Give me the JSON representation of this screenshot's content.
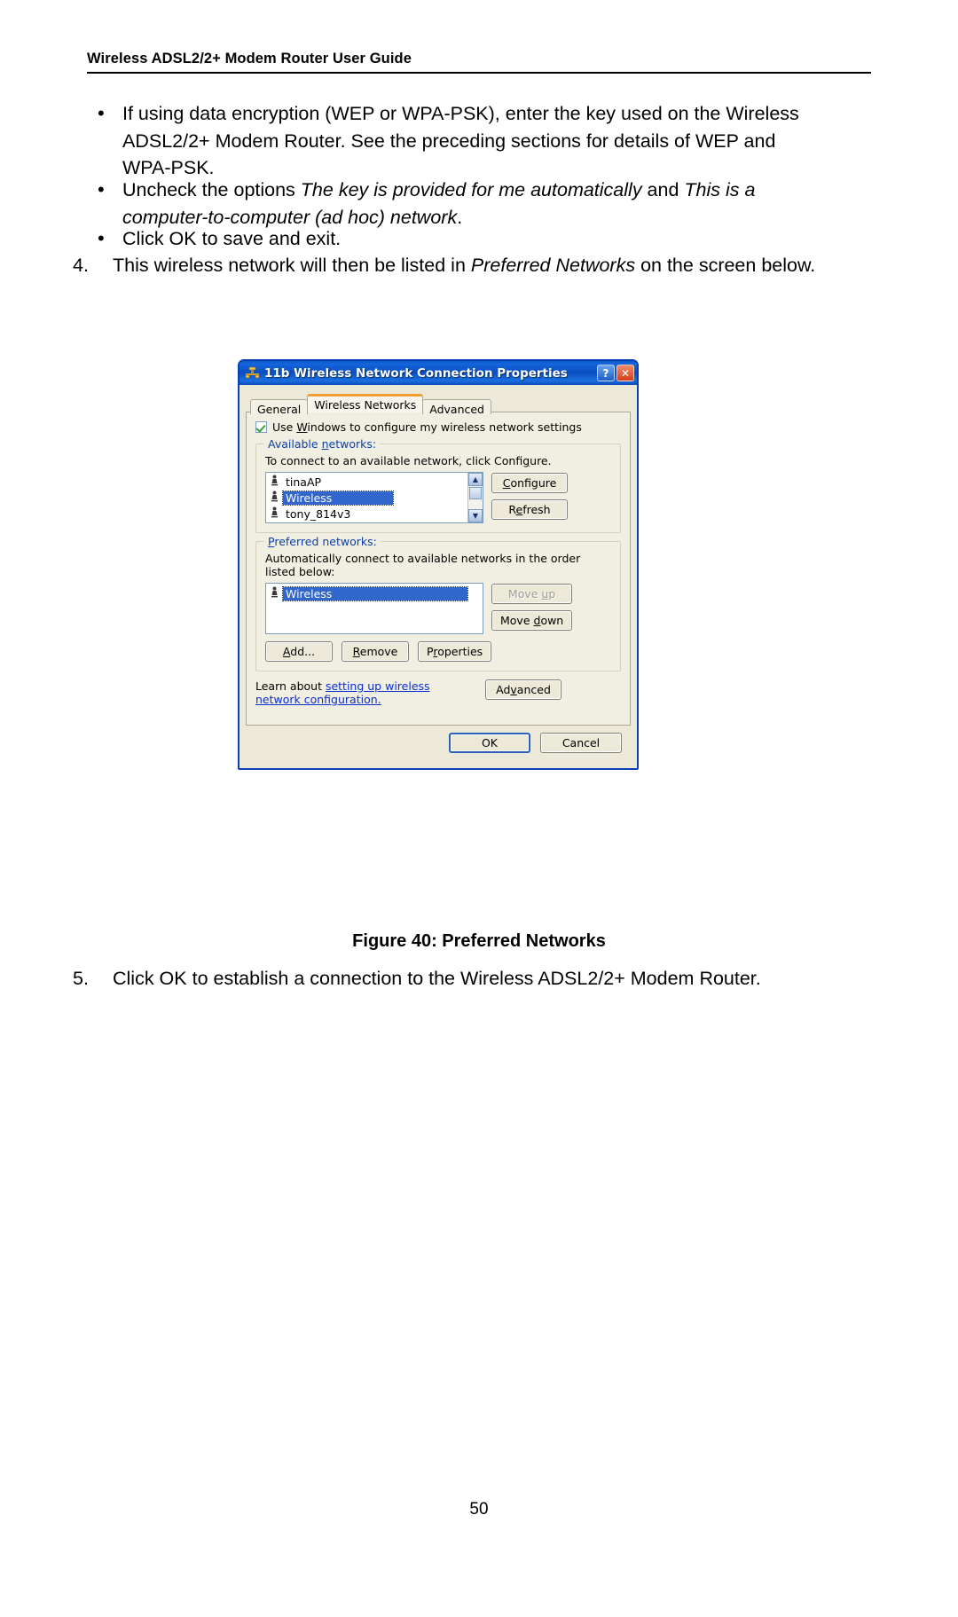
{
  "document": {
    "running_header": "Wireless ADSL2/2+ Modem Router User Guide",
    "page_number": "50",
    "figure_caption": "Figure 40: Preferred Networks"
  },
  "body": {
    "bullets": [
      {
        "marker": "•",
        "text_parts": [
          {
            "text": "If using data encryption (WEP or WPA-PSK), enter the key used on the Wireless ADSL2/2+ Modem Router. See the preceding sections for details of WEP and WPA-PSK.",
            "italic": false
          }
        ]
      },
      {
        "marker": "•",
        "text_parts": [
          {
            "text": "Uncheck the options ",
            "italic": false
          },
          {
            "text": "The key is provided for me automatically",
            "italic": true
          },
          {
            "text": " and ",
            "italic": false
          },
          {
            "text": "This is a computer-to-computer (ad hoc) network",
            "italic": true
          },
          {
            "text": ".",
            "italic": false
          }
        ]
      },
      {
        "marker": "•",
        "text_parts": [
          {
            "text": "Click OK to save and exit.",
            "italic": false
          }
        ]
      }
    ],
    "step4": {
      "number": "4.",
      "parts": [
        {
          "text": "This wireless network will then be listed in ",
          "italic": false
        },
        {
          "text": "Preferred Networks",
          "italic": true
        },
        {
          "text": " on the screen below.",
          "italic": false
        }
      ]
    },
    "step5": {
      "number": "5.",
      "parts": [
        {
          "text": "Click OK to establish a connection to the Wireless ADSL2/2+ Modem Router.",
          "italic": false
        }
      ]
    }
  },
  "dialog": {
    "title": "11b Wireless Network Connection Properties",
    "title_icon": "network-connection-icon",
    "help_button": "?",
    "close_button": "✕",
    "tabs": [
      {
        "label": "General",
        "active": false
      },
      {
        "label": "Wireless Networks",
        "active": true
      },
      {
        "label": "Advanced",
        "active": false
      }
    ],
    "use_windows_checkbox": {
      "checked": true,
      "pre": "Use ",
      "accel": "W",
      "post": "indows to configure my wireless network settings"
    },
    "available_networks": {
      "group_pre": "Available ",
      "group_accel": "n",
      "group_post": "etworks:",
      "description_pre": "To connect to an available network, click Confi",
      "description_accel": "g",
      "description_post": "ure.",
      "items": [
        {
          "name": "tinaAP",
          "selected": false
        },
        {
          "name": "Wireless",
          "selected": true
        },
        {
          "name": "tony_814v3",
          "selected": false
        }
      ],
      "buttons": [
        {
          "pre": "",
          "accel": "C",
          "post": "onfigure",
          "label": "Configure",
          "disabled": false
        },
        {
          "pre": "R",
          "accel": "e",
          "post": "fresh",
          "label": "Refresh",
          "disabled": false
        }
      ],
      "scroll_up": "▲",
      "scroll_down": "▼"
    },
    "preferred_networks": {
      "group_pre": "",
      "group_accel": "P",
      "group_post": "referred networks:",
      "description": "Automatically connect to available networks in the order listed below:",
      "items": [
        {
          "name": "Wireless",
          "selected": true
        }
      ],
      "buttons": [
        {
          "pre": "Move ",
          "accel": "u",
          "post": "p",
          "label": "Move up",
          "disabled": true
        },
        {
          "pre": "Move ",
          "accel": "d",
          "post": "own",
          "label": "Move down",
          "disabled": false
        }
      ],
      "action_buttons": [
        {
          "pre": "",
          "accel": "A",
          "post": "dd...",
          "label": "Add...",
          "disabled": false
        },
        {
          "pre": "",
          "accel": "R",
          "post": "emove",
          "label": "Remove",
          "disabled": false
        },
        {
          "pre": "P",
          "accel": "r",
          "post": "operties",
          "label": "Properties",
          "disabled": false
        }
      ]
    },
    "learn_about": {
      "prefix": "Learn about ",
      "link_text": "setting up wireless network configuration.",
      "button": {
        "pre": "Ad",
        "accel": "v",
        "post": "anced",
        "label": "Advanced"
      }
    },
    "footer_buttons": [
      {
        "label": "OK",
        "default": true
      },
      {
        "label": "Cancel",
        "default": false
      }
    ]
  },
  "colors": {
    "titlebar_blue": "#0a4ec0",
    "dialog_face": "#ece9d8",
    "panel_face": "#f1efe2",
    "selection_blue": "#3166cc",
    "group_label_blue": "#0a3fa8",
    "link_blue": "#0a2fcf",
    "active_tab_accent": "#f0a030",
    "check_green": "#3a9e32"
  }
}
